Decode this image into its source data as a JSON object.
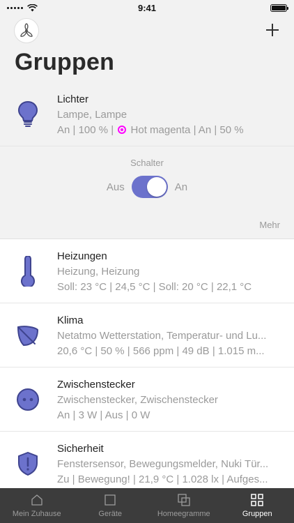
{
  "status_bar": {
    "time": "9:41"
  },
  "header": {
    "title": "Gruppen",
    "add_label": "+"
  },
  "groups": [
    {
      "name": "Lichter",
      "line1": "Lampe, Lampe",
      "line2_pre": "An | 100 % | ",
      "line2_color_name": "Hot magenta",
      "line2_post": " | An | 50 %",
      "color": "#ff00ff"
    },
    {
      "name": "Heizungen",
      "line1": "Heizung, Heizung",
      "line2": "Soll: 23 °C | 24,5 °C | Soll: 20 °C | 22,1 °C"
    },
    {
      "name": "Klima",
      "line1": "Netatmo Wetterstation, Temperatur- und Lu...",
      "line2": "20,6 °C | 50 % | 566 ppm | 49 dB | 1.015 m..."
    },
    {
      "name": "Zwischenstecker",
      "line1": "Zwischenstecker, Zwischenstecker",
      "line2": "An | 3 W | Aus | 0 W"
    },
    {
      "name": "Sicherheit",
      "line1": "Fenstersensor, Bewegungsmelder, Nuki Tür...",
      "line2": "Zu | Bewegung! | 21,9 °C | 1.028 lx | Aufges..."
    }
  ],
  "switch_panel": {
    "label": "Schalter",
    "off_label": "Aus",
    "on_label": "An",
    "state": "on",
    "more_label": "Mehr"
  },
  "tabs": [
    {
      "label": "Mein Zuhause",
      "icon": "home-icon"
    },
    {
      "label": "Geräte",
      "icon": "device-icon"
    },
    {
      "label": "Homeegramme",
      "icon": "homeegram-icon"
    },
    {
      "label": "Gruppen",
      "icon": "groups-icon",
      "active": true
    }
  ],
  "colors": {
    "accent": "#6c72cc",
    "tab_bar": "#3c3c3c",
    "magenta": "#ff00ff"
  }
}
